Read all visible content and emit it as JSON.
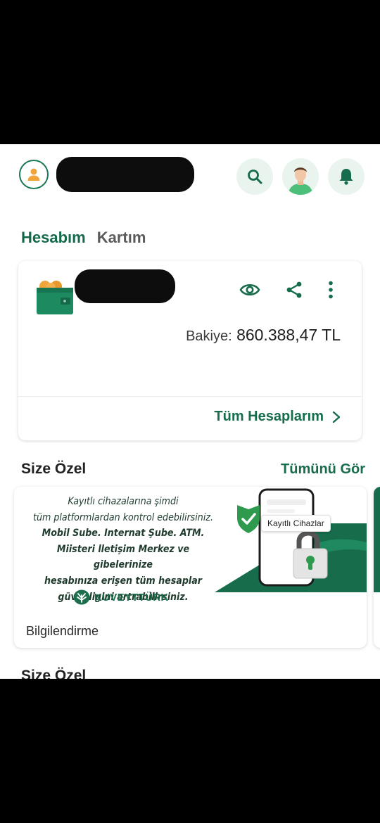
{
  "tabs": {
    "active": "Hesabım",
    "inactive": "Kartım"
  },
  "account": {
    "balance_label": "Bakiye:",
    "balance_value": "860.388,47 TL",
    "all_accounts": "Tüm Hesaplarım"
  },
  "sections": {
    "title": "Size Özel",
    "see_all": "Tümünü Gör",
    "second_title": "Size Özel"
  },
  "promo": {
    "lines": [
      "Kayıtlı cihazalarına şimdi",
      "tüm platformlardan kontrol edebilirsiniz.",
      "Mobil Sube. Internat Şube. ATM.",
      "Miisteri lletişim Merkez ve gibelerinize",
      "hesabınıza erişen tüm hesaplar",
      "güvenligini artrabilirsiniz."
    ],
    "brand": "KUVEYTTÜRK",
    "phone_tag": "Kayıtlı Cihazlar",
    "label": "Bilgilendirme"
  },
  "colors": {
    "primary": "#176c4c",
    "accent_bg": "#e9f4ef",
    "balance_text": "#1e1e1e"
  },
  "icons": [
    "user-icon",
    "search-icon",
    "profile-photo",
    "bell-icon",
    "wallet-icon",
    "eye-icon",
    "share-icon",
    "more-vertical-icon",
    "chevron-right-icon",
    "shield-check-icon",
    "lock-icon"
  ]
}
